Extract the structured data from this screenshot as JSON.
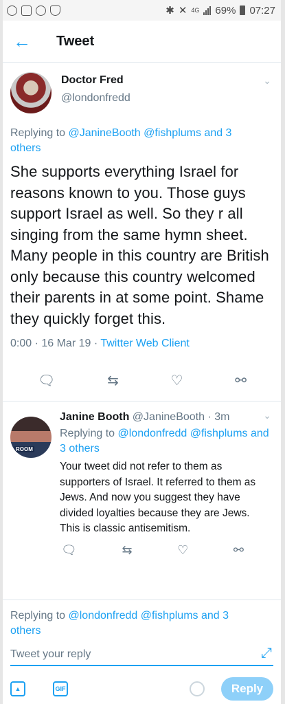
{
  "status_bar": {
    "battery": "69%",
    "time": "07:27",
    "network": "4G",
    "left_icons": [
      "whatsapp-icon",
      "gallery-icon",
      "whatsapp-icon",
      "shield-icon"
    ]
  },
  "header": {
    "back_icon": "arrow-left-icon",
    "title": "Tweet"
  },
  "main_tweet": {
    "name": "Doctor Fred",
    "handle": "@londonfredd",
    "replying_prefix": "Replying to",
    "replying_mentions": "@JanineBooth @fishplums and 3",
    "replying_others": "others",
    "text": "She supports everything Israel for reasons known to you. Those guys support Israel as well. So they r all singing from the same hymn sheet. Many people in this country are British only because this country welcomed their parents in at some point. Shame they quickly forget this.",
    "time": "0:00 · 16 Mar 19 · ",
    "source": "Twitter Web Client"
  },
  "reply_tweet": {
    "name": "Janine Booth",
    "handle_time": "@JanineBooth · 3m",
    "avatar_text": "ROOM",
    "replying_prefix": "Replying to",
    "replying_mentions": "@londonfredd @fishplums and 3 others",
    "text_lines": [
      "Your tweet did not refer to them as supporters of Israel. It referred to them as Jews. And now you suggest they have divided loyalties because they are Jews.",
      "This is classic antisemitism."
    ]
  },
  "composer": {
    "replying_prefix": "Replying to",
    "replying_mentions": "@londonfredd @fishplums and 3",
    "replying_others": "others",
    "placeholder": "Tweet your reply",
    "gif_label": "GIF",
    "reply_label": "Reply"
  },
  "colors": {
    "accent": "#1da1f2",
    "muted": "#657786",
    "reply_button": "#8ed0f9"
  }
}
